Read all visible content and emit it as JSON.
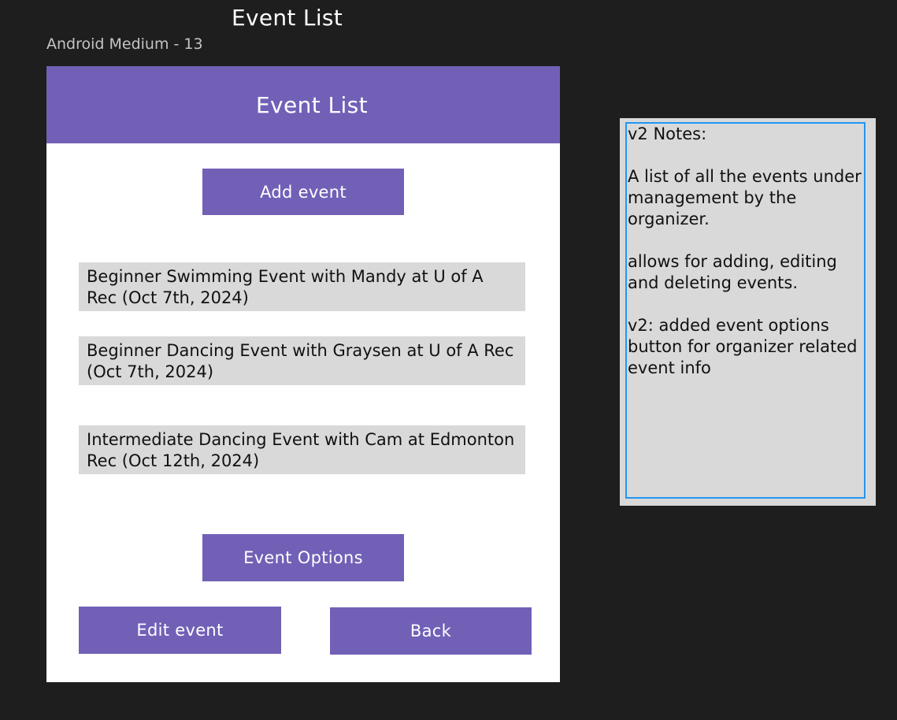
{
  "canvas": {
    "title": "Event List",
    "frame_label": "Android Medium - 13"
  },
  "app": {
    "header_title": "Event List",
    "add_event_label": "Add event",
    "events": [
      {
        "label": "Beginner Swimming Event with Mandy at U of A Rec (Oct 7th, 2024)"
      },
      {
        "label": "Beginner Dancing Event with Graysen at U of A Rec (Oct 7th, 2024)"
      },
      {
        "label": "Intermediate Dancing Event with Cam at Edmonton Rec (Oct 12th, 2024)"
      }
    ],
    "event_options_label": "Event Options",
    "edit_event_label": "Edit event",
    "back_label": "Back"
  },
  "notes": {
    "heading": "v2 Notes:",
    "paragraph_1": "A list of all the events under management by the organizer.",
    "paragraph_2": "allows for adding, editing and deleting events.",
    "paragraph_3": "v2: added event options button for organizer related event info"
  },
  "colors": {
    "canvas_background": "#1e1e1e",
    "accent": "#7260b7",
    "list_item_background": "#d9d9d9",
    "selection_border": "#2196f3"
  }
}
